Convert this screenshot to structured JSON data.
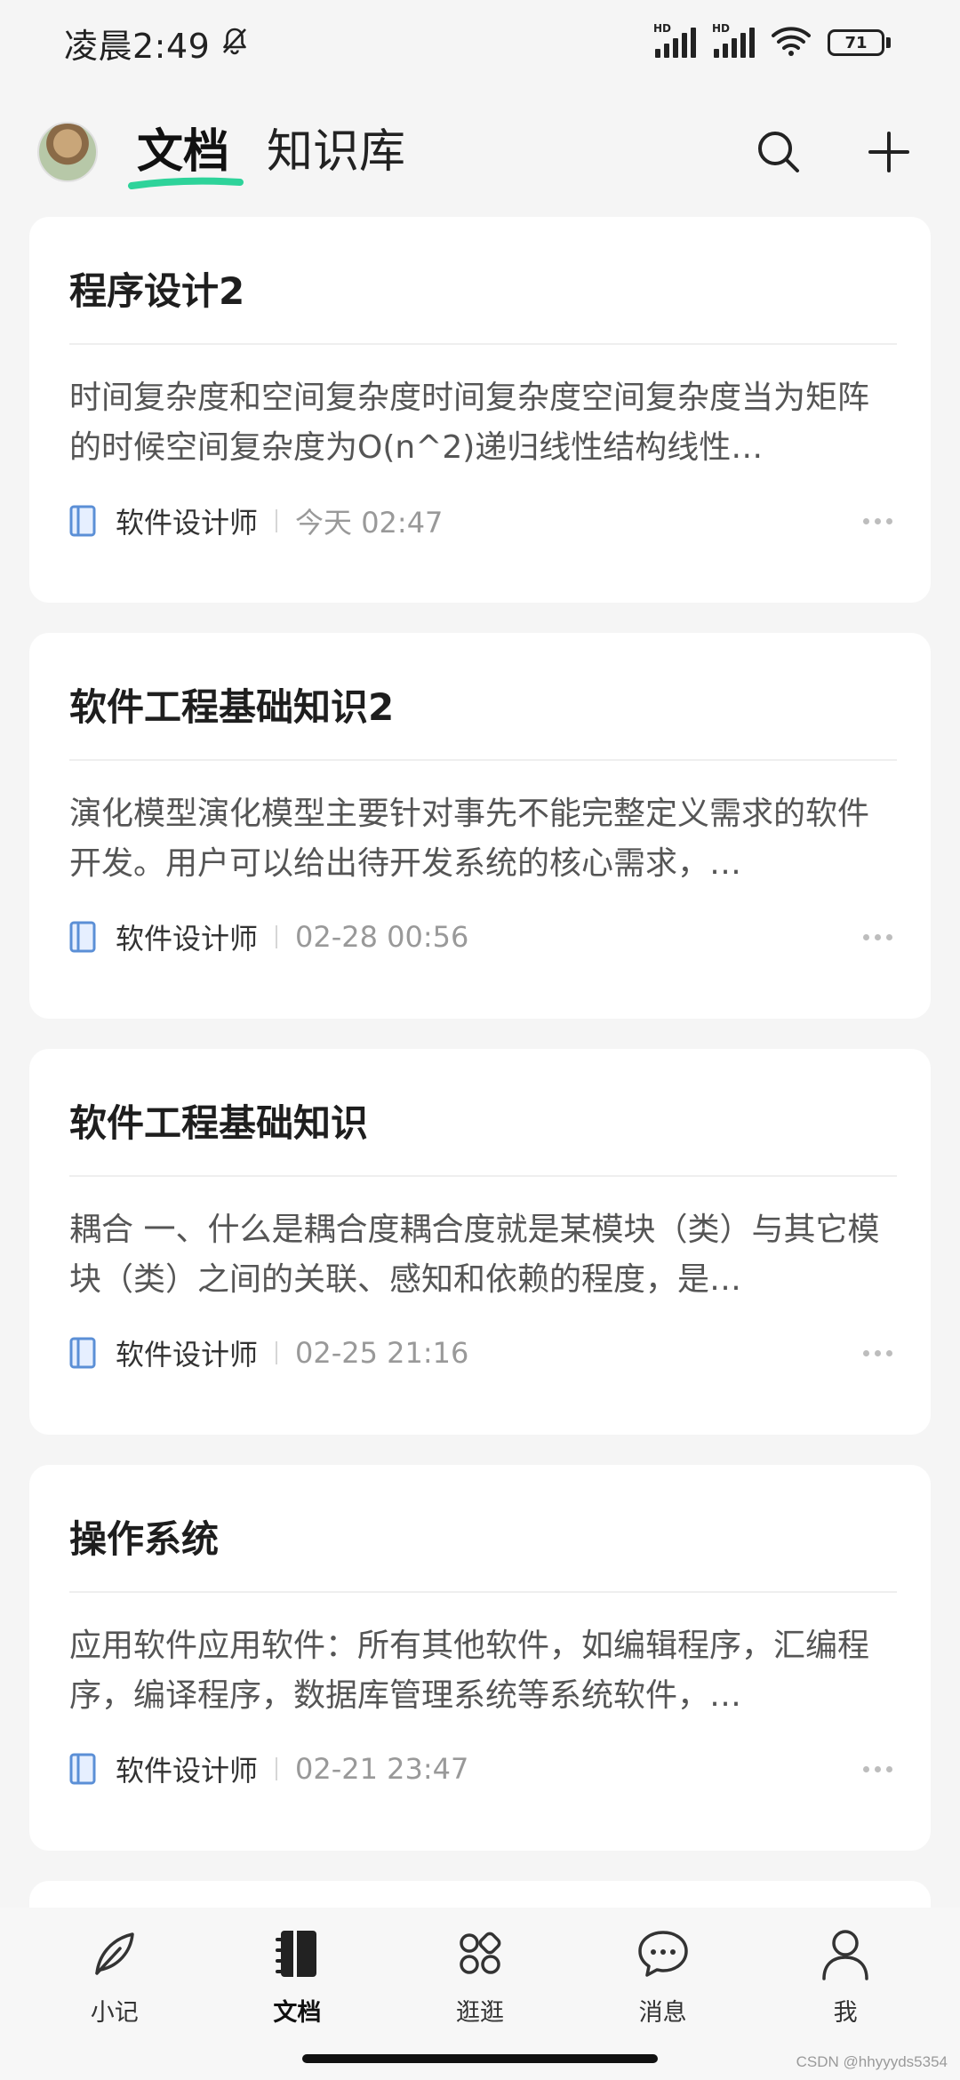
{
  "status_bar": {
    "time": "凌晨2:49",
    "battery": "71",
    "signal1_label": "HD",
    "signal2_label": "HD",
    "icons": [
      "bell-off-icon",
      "signal-icon",
      "signal-icon",
      "wifi-icon",
      "battery-icon"
    ]
  },
  "header": {
    "tabs": [
      {
        "label": "文档",
        "active": true
      },
      {
        "label": "知识库",
        "active": false
      }
    ],
    "actions": [
      "search-icon",
      "plus-icon"
    ]
  },
  "documents": [
    {
      "title": "程序设计2",
      "excerpt": "时间复杂度和空间复杂度时间复杂度空间复杂度当为矩阵的时候空间复杂度为O(n^2)递归线性结构线性…",
      "knowledge_base": "软件设计师",
      "time": "今天 02:47"
    },
    {
      "title": "软件工程基础知识2",
      "excerpt": "演化模型演化模型主要针对事先不能完整定义需求的软件开发。用户可以给出待开发系统的核心需求，…",
      "knowledge_base": "软件设计师",
      "time": "02-28 00:56"
    },
    {
      "title": "软件工程基础知识",
      "excerpt": "耦合 一、什么是耦合度耦合度就是某模块（类）与其它模块（类）之间的关联、感知和依赖的程度，是…",
      "knowledge_base": "软件设计师",
      "time": "02-25 21:16"
    },
    {
      "title": "操作系统",
      "excerpt": "应用软件应用软件：所有其他软件，如编辑程序，汇编程序，编译程序，数据库管理系统等系统软件，…",
      "knowledge_base": "软件设计师",
      "time": "02-21 23:47"
    }
  ],
  "bottom_nav": [
    {
      "label": "小记",
      "icon": "feather-icon",
      "active": false
    },
    {
      "label": "文档",
      "icon": "notebook-icon",
      "active": true
    },
    {
      "label": "逛逛",
      "icon": "grid-icon",
      "active": false
    },
    {
      "label": "消息",
      "icon": "chat-icon",
      "active": false
    },
    {
      "label": "我",
      "icon": "user-icon",
      "active": false
    }
  ],
  "watermark": "CSDN @hhyyyds5354",
  "colors": {
    "accent_underline": "#2ed39a",
    "book_icon": "#5b8fd6",
    "background": "#f5f5f5"
  }
}
